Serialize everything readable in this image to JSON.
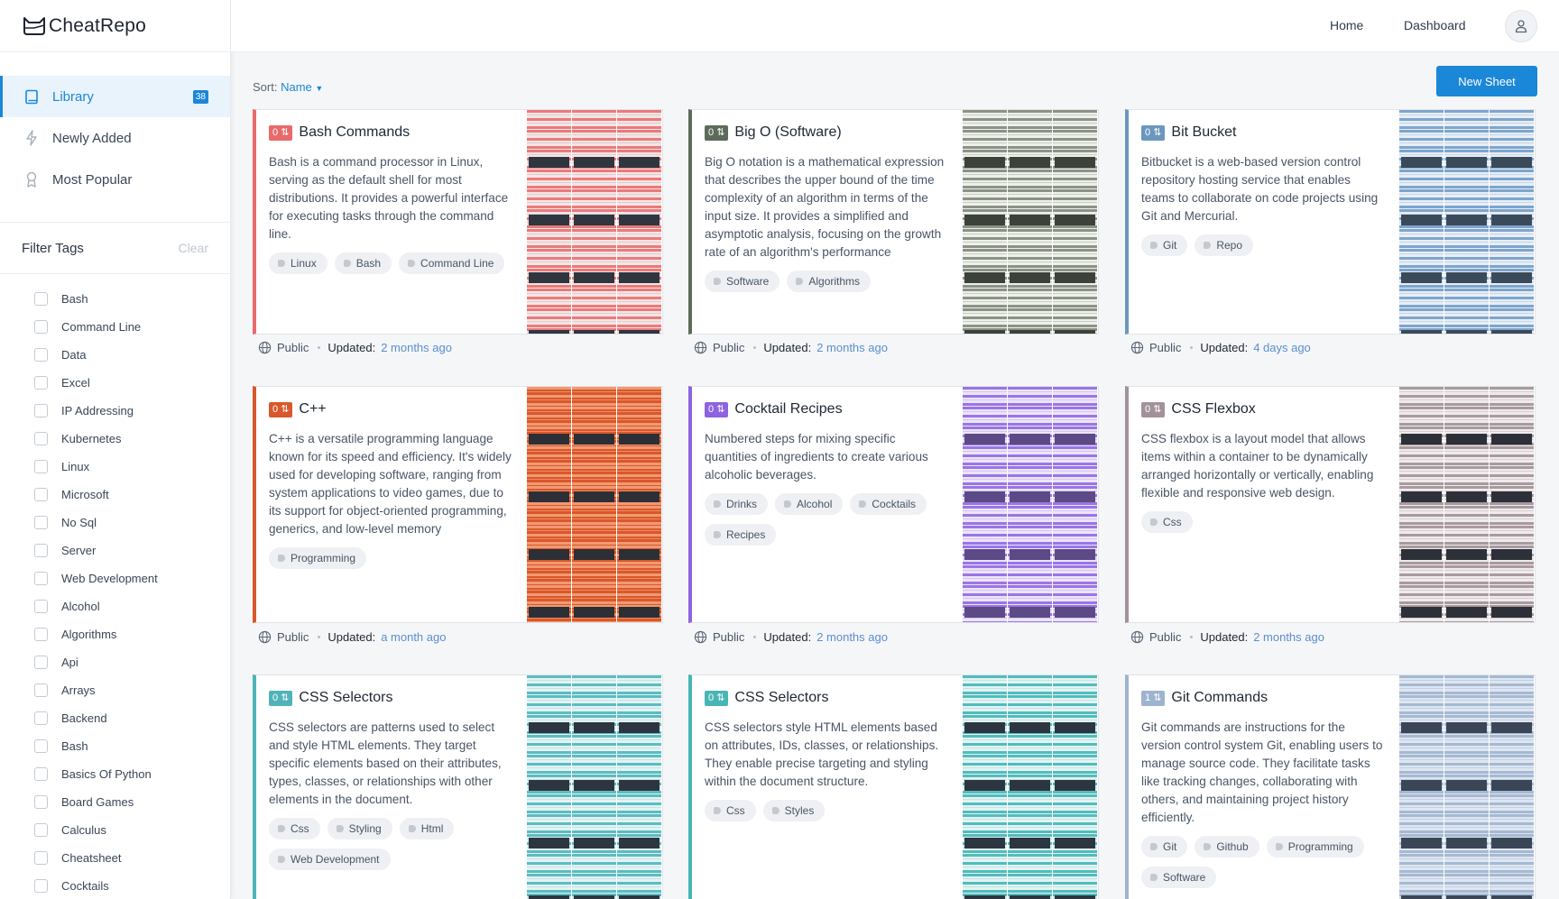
{
  "brand": {
    "name": "CheatRepo"
  },
  "nav": {
    "items": [
      {
        "label": "Library",
        "badge": "38",
        "icon": "book-icon"
      },
      {
        "label": "Newly Added",
        "icon": "bolt-icon"
      },
      {
        "label": "Most Popular",
        "icon": "award-icon"
      }
    ]
  },
  "filter": {
    "title": "Filter Tags",
    "clear": "Clear",
    "tags": [
      "Bash",
      "Command Line",
      "Data",
      "Excel",
      "IP Addressing",
      "Kubernetes",
      "Linux",
      "Microsoft",
      "No Sql",
      "Server",
      "Web Development",
      "Alcohol",
      "Algorithms",
      "Api",
      "Arrays",
      "Backend",
      "Bash",
      "Basics Of Python",
      "Board Games",
      "Calculus",
      "Cheatsheet",
      "Cocktails"
    ]
  },
  "topbar": {
    "home": "Home",
    "dashboard": "Dashboard"
  },
  "sort": {
    "label": "Sort:",
    "value": "Name"
  },
  "actions": {
    "new_sheet": "New Sheet"
  },
  "meta_labels": {
    "visibility": "Public",
    "updated": "Updated:"
  },
  "colors": {
    "accent": "#1b87d8"
  },
  "cards": [
    {
      "title": "Bash Commands",
      "votes": "0",
      "color": "#e86a6a",
      "desc": "Bash is a command processor in Linux, serving as the default shell for most distributions. It provides a powerful interface for executing tasks through the command line.",
      "tags": [
        "Linux",
        "Bash",
        "Command Line"
      ],
      "updated": "2 months ago"
    },
    {
      "title": "Big O (Software)",
      "votes": "0",
      "color": "#5e6b5a",
      "desc": "Big O notation is a mathematical expression that describes the upper bound of the time complexity of an algorithm in terms of the input size. It provides a simplified and asymptotic analysis, focusing on the growth rate of an algorithm's performance",
      "tags": [
        "Software",
        "Algorithms"
      ],
      "updated": "2 months ago"
    },
    {
      "title": "Bit Bucket",
      "votes": "0",
      "color": "#6b97bf",
      "desc": "Bitbucket is a web-based version control repository hosting service that enables teams to collaborate on code projects using Git and Mercurial.",
      "tags": [
        "Git",
        "Repo"
      ],
      "updated": "4 days ago"
    },
    {
      "title": "C++",
      "votes": "0",
      "color": "#d9582b",
      "desc": "C++ is a versatile programming language known for its speed and efficiency. It's widely used for developing software, ranging from system applications to video games, due to its support for object-oriented programming, generics, and low-level memory",
      "tags": [
        "Programming"
      ],
      "updated": "a month ago"
    },
    {
      "title": "Cocktail Recipes",
      "votes": "0",
      "color": "#8c63e0",
      "desc": "Numbered steps for mixing specific quantities of ingredients to create various alcoholic beverages.",
      "tags": [
        "Drinks",
        "Alcohol",
        "Cocktails",
        "Recipes"
      ],
      "updated": "2 months ago"
    },
    {
      "title": "CSS Flexbox",
      "votes": "0",
      "color": "#a3919a",
      "desc": "CSS flexbox is a layout model that allows items within a container to be dynamically arranged horizontally or vertically, enabling flexible and responsive web design.",
      "tags": [
        "Css"
      ],
      "updated": "2 months ago"
    },
    {
      "title": "CSS Selectors",
      "votes": "0",
      "color": "#4fb3b8",
      "desc": "CSS selectors are patterns used to select and style HTML elements. They target specific elements based on their attributes, types, classes, or relationships with other elements in the document.",
      "tags": [
        "Css",
        "Styling",
        "Html",
        "Web Development"
      ],
      "updated": ""
    },
    {
      "title": "CSS Selectors",
      "votes": "0",
      "color": "#48b5b5",
      "desc": "CSS selectors style HTML elements based on attributes, IDs, classes, or relationships. They enable precise targeting and styling within the document structure.",
      "tags": [
        "Css",
        "Styles"
      ],
      "updated": ""
    },
    {
      "title": "Git Commands",
      "votes": "1",
      "color": "#9eb3cf",
      "desc": "Git commands are instructions for the version control system Git, enabling users to manage source code. They facilitate tasks like tracking changes, collaborating with others, and maintaining project history efficiently.",
      "tags": [
        "Git",
        "Github",
        "Programming",
        "Software"
      ],
      "updated": ""
    }
  ]
}
